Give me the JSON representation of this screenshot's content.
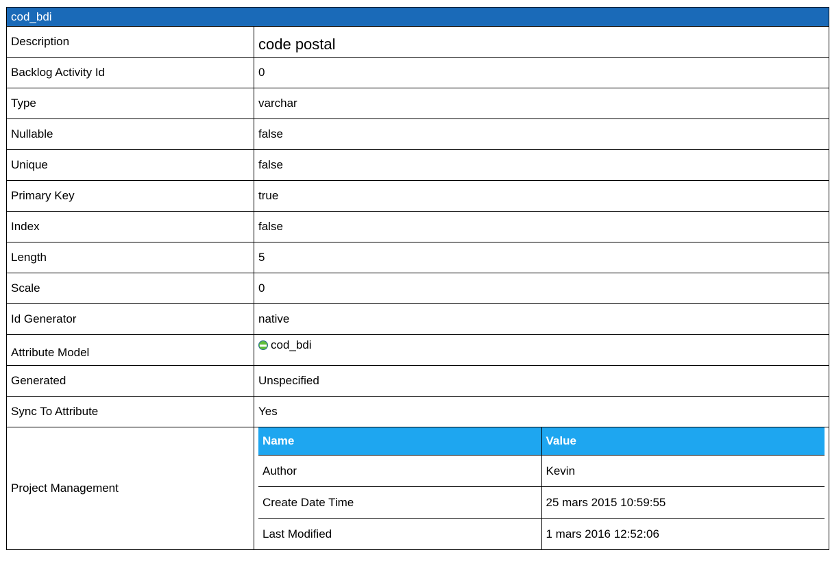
{
  "title": "cod_bdi",
  "rows": [
    {
      "label": "Description",
      "value": "code postal"
    },
    {
      "label": "Backlog Activity Id",
      "value": "0"
    },
    {
      "label": "Type",
      "value": "varchar"
    },
    {
      "label": "Nullable",
      "value": "false"
    },
    {
      "label": "Unique",
      "value": "false"
    },
    {
      "label": "Primary Key",
      "value": "true"
    },
    {
      "label": "Index",
      "value": "false"
    },
    {
      "label": "Length",
      "value": "5"
    },
    {
      "label": "Scale",
      "value": "0"
    },
    {
      "label": "Id Generator",
      "value": "native"
    },
    {
      "label": "Attribute Model",
      "value": "cod_bdi",
      "icon": "attribute-icon"
    },
    {
      "label": "Generated",
      "value": "Unspecified"
    },
    {
      "label": "Sync To Attribute",
      "value": "Yes"
    }
  ],
  "project_management": {
    "label": "Project Management",
    "headers": [
      "Name",
      "Value"
    ],
    "rows": [
      {
        "name": "Author",
        "value": "Kevin"
      },
      {
        "name": "Create Date Time",
        "value": "25 mars 2015 10:59:55"
      },
      {
        "name": "Last Modified",
        "value": "1 mars 2016 12:52:06"
      }
    ]
  },
  "colors": {
    "header": "#1a6ab8",
    "subheader": "#1ea6f0"
  }
}
